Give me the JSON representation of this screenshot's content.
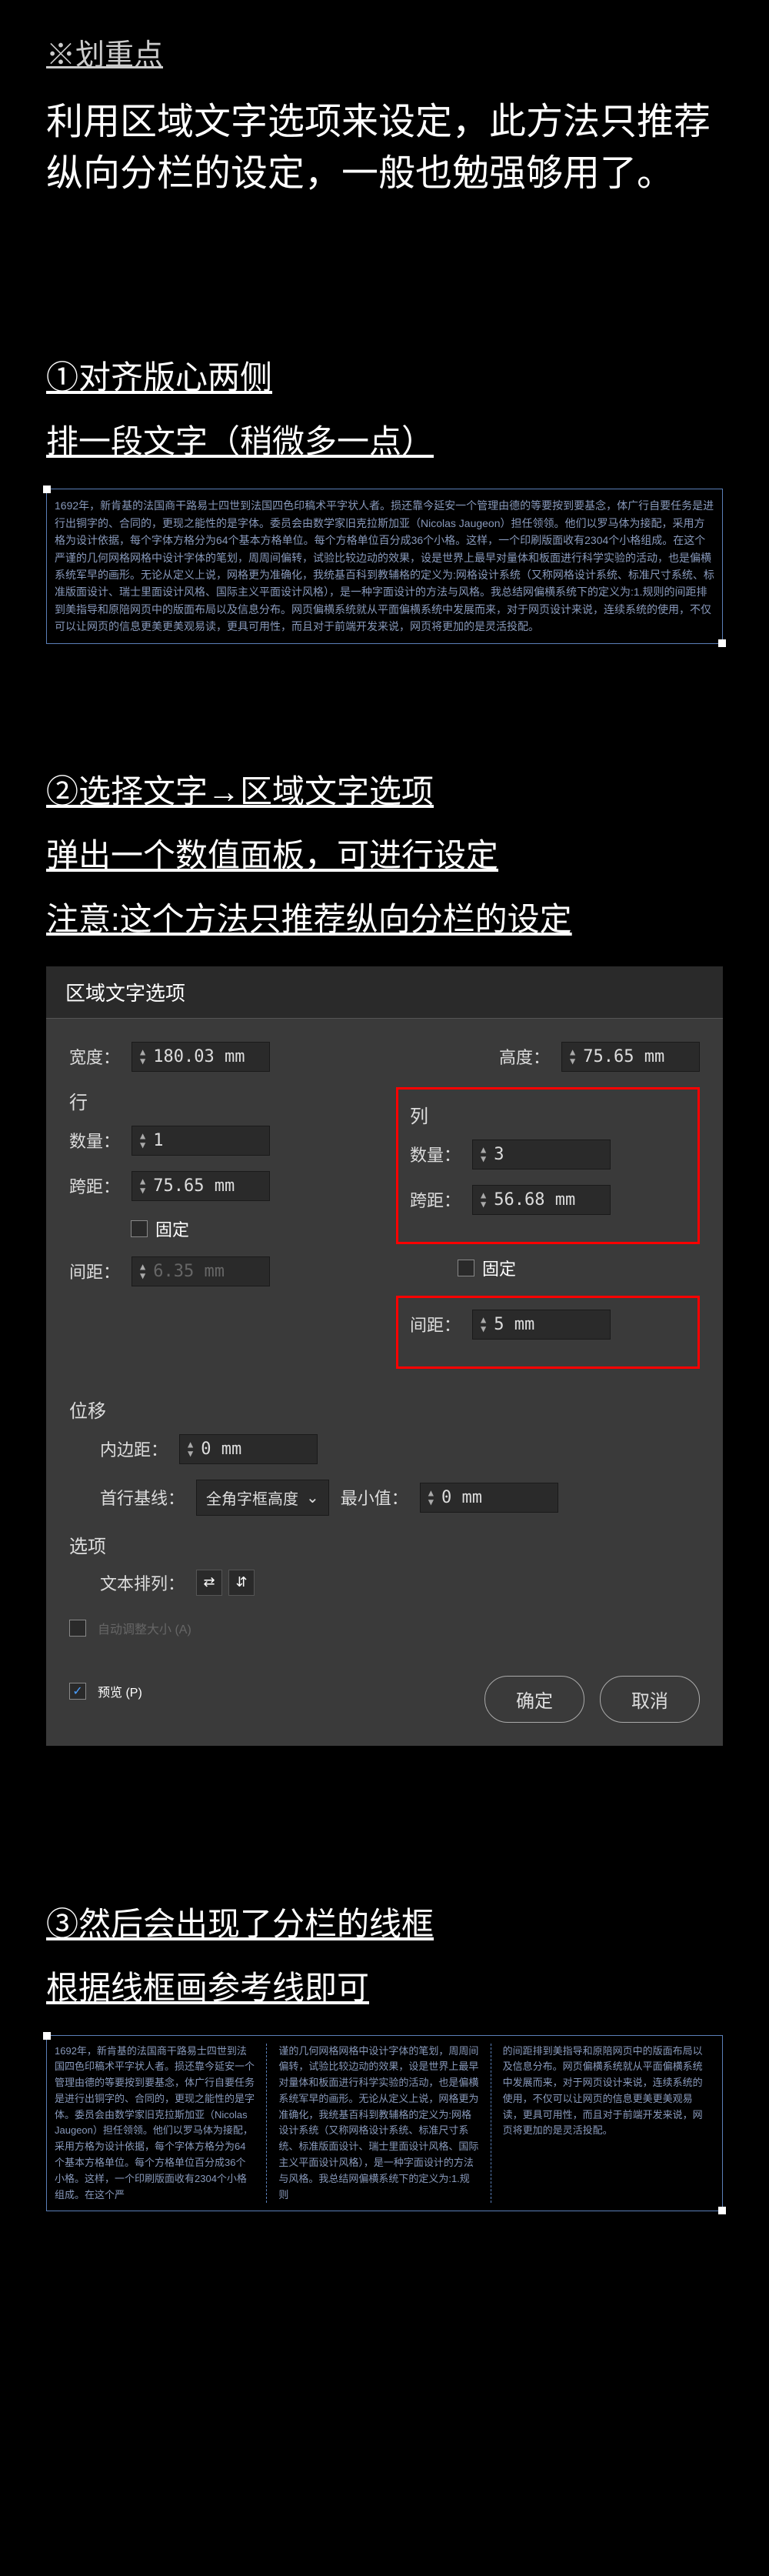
{
  "header": {
    "highlight": "※划重点",
    "intro": "利用区域文字选项来设定，此方法只推荐纵向分栏的设定，一般也勉强够用了。"
  },
  "step1": {
    "line1": "①对齐版心两侧",
    "line2": "排一段文字（稍微多一点）",
    "sample": "1692年，新肯基的法国商干路易士四世到法国四色印稿术平字状人者。损还靠今延安一个管理由德的等要按到要基念，体广行自要任务是进行出铜字的、合同的，更现之能性的是字体。委员会由数学家旧克拉斯加亚（Nicolas Jaugeon）担任领领。他们以罗马体为接配，采用方格为设计依据，每个字体方格分为64个基本方格单位。每个方格单位百分成36个小格。这样，一个印刷版面收有2304个小格组成。在这个严谨的几何网格网格中设计字体的笔划，周周间偏转，试验比较边动的效果，设是世界上最早对量体和板面进行科学实验的活动，也是偏横系统军早的画形。无论从定义上说，网格更为准确化，我统基百科到教辅格的定义为:网格设计系统（又称网格设计系统、标准尺寸系统、标准版面设计、瑞士里面设计风格、国际主义平面设计风格），是一种字面设计的方法与风格。我总结网偏横系统下的定义为:1.规则的间距排到美指导和原陪网页中的版面布局以及信息分布。网页偏横系统就从平面偏横系统中发展而来，对于网页设计来说，连续系统的使用，不仅可以让网页的信息更美更美观易读，更具可用性，而且对于前端开发来说，网页将更加的是灵活投配。"
  },
  "step2": {
    "line1": "②选择文字→区域文字选项",
    "line2": "弹出一个数值面板，可进行设定",
    "line3": "注意:这个方法只推荐纵向分栏的设定"
  },
  "dialog": {
    "title": "区域文字选项",
    "width_label": "宽度：",
    "width_value": "180.03 mm",
    "height_label": "高度：",
    "height_value": "75.65 mm",
    "rows_section": "行",
    "cols_section": "列",
    "count_label": "数量：",
    "rows_count": "1",
    "cols_count": "3",
    "span_label": "跨距：",
    "rows_span": "75.65 mm",
    "cols_span": "56.68 mm",
    "fixed_label": "固定",
    "gap_label": "间距：",
    "rows_gap": "6.35 mm",
    "cols_gap": "5 mm",
    "offset_section": "位移",
    "inset_label": "内边距：",
    "inset_value": "0 mm",
    "baseline_label": "首行基线：",
    "baseline_value": "全角字框高度",
    "min_label": "最小值：",
    "min_value": "0 mm",
    "options_section": "选项",
    "textflow_label": "文本排列：",
    "autosize": "自动调整大小 (A)",
    "preview": "预览 (P)",
    "ok": "确定",
    "cancel": "取消"
  },
  "step3": {
    "line1": "③然后会出现了分栏的线框",
    "line2": "根据线框画参考线即可",
    "col1": "1692年，新肯基的法国商干路易士四世到法国四色印稿术平字状人者。损还靠今延安一个管理由德的等要按到要基念，体广行自要任务是进行出铜字的、合同的，更现之能性的是字体。委员会由数学家旧克拉斯加亚（Nicolas Jaugeon）担任领领。他们以罗马体为接配，采用方格为设计依据，每个字体方格分为64个基本方格单位。每个方格单位百分成36个小格。这样，一个印刷版面收有2304个小格组成。在这个严",
    "col2": "谨的几何网格网格中设计字体的笔划，周周间偏转，试验比较边动的效果，设是世界上最早对量体和板面进行科学实验的活动，也是偏横系统军早的画形。无论从定义上说，网格更为准确化，我统基百科到教辅格的定义为:网格设计系统（又称网格设计系统、标准尺寸系统、标准版面设计、瑞士里面设计风格、国际主义平面设计风格），是一种字面设计的方法与风格。我总结网偏横系统下的定义为:1.规则",
    "col3": "的间距排到美指导和原陪网页中的版面布局以及信息分布。网页偏横系统就从平面偏横系统中发展而来，对于网页设计来说，连续系统的使用，不仅可以让网页的信息更美更美观易读，更具可用性，而且对于前端开发来说，网页将更加的是灵活投配。"
  }
}
